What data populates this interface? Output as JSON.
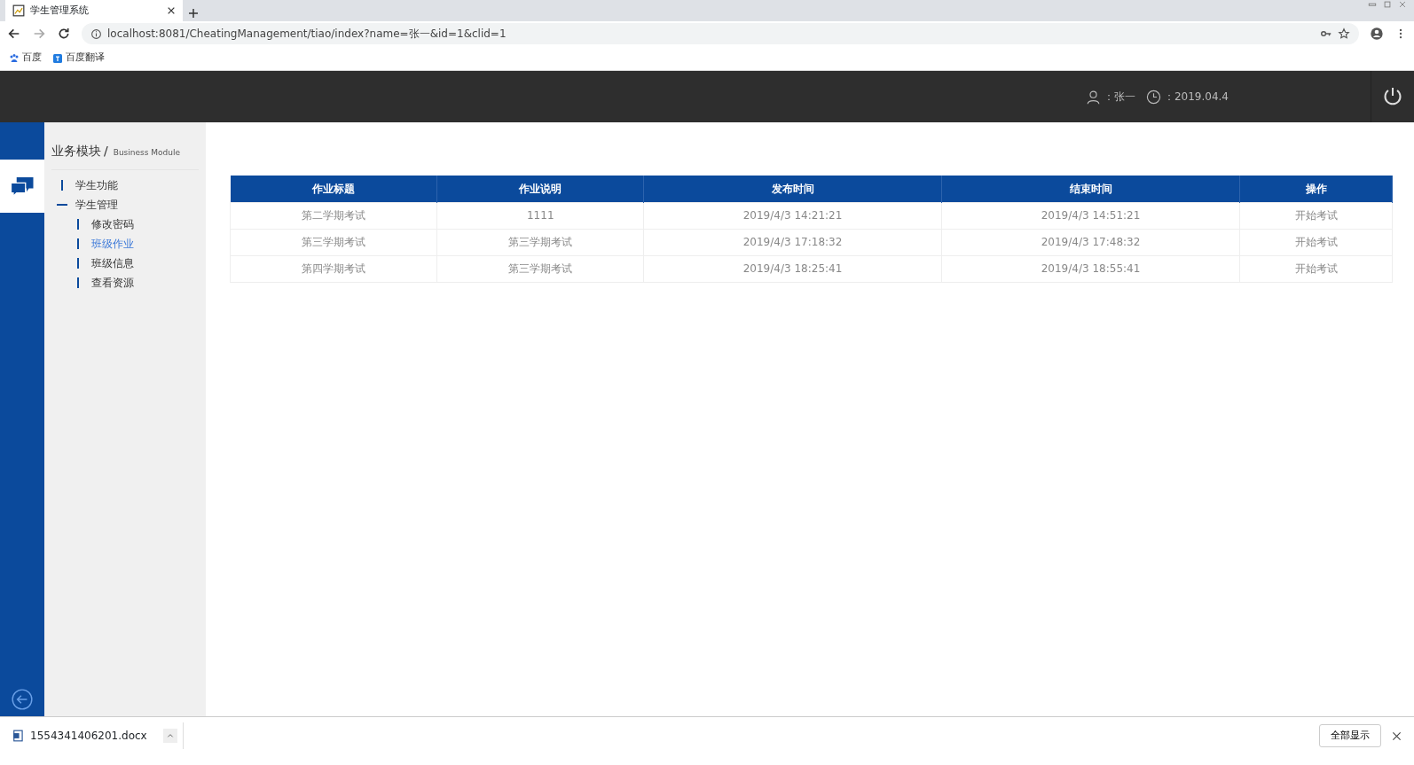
{
  "browser": {
    "tab_title": "学生管理系统",
    "url": "localhost:8081/CheatingManagement/tiao/index?name=张一&id=1&clid=1",
    "bookmarks": [
      "百度",
      "百度翻译"
    ]
  },
  "header": {
    "user": "：张一",
    "date": "：2019.04.4"
  },
  "sidebar": {
    "heading": "业务模块",
    "separator": "/",
    "subheading": "Business Module",
    "menu": [
      {
        "label": "学生功能",
        "expanded": false
      },
      {
        "label": "学生管理",
        "expanded": true,
        "children": [
          {
            "label": "修改密码",
            "selected": false
          },
          {
            "label": "班级作业",
            "selected": true
          },
          {
            "label": "班级信息",
            "selected": false
          },
          {
            "label": "查看资源",
            "selected": false
          }
        ]
      }
    ]
  },
  "table": {
    "columns": [
      "作业标题",
      "作业说明",
      "发布时间",
      "结束时间",
      "操作"
    ],
    "rows": [
      [
        "第二学期考试",
        "1111",
        "2019/4/3 14:21:21",
        "2019/4/3 14:51:21",
        "开始考试"
      ],
      [
        "第三学期考试",
        "第三学期考试",
        "2019/4/3 17:18:32",
        "2019/4/3 17:48:32",
        "开始考试"
      ],
      [
        "第四学期考试",
        "第三学期考试",
        "2019/4/3 18:25:41",
        "2019/4/3 18:55:41",
        "开始考试"
      ]
    ]
  },
  "downloads": {
    "file": "1554341406201.docx",
    "show_all": "全部显示"
  }
}
